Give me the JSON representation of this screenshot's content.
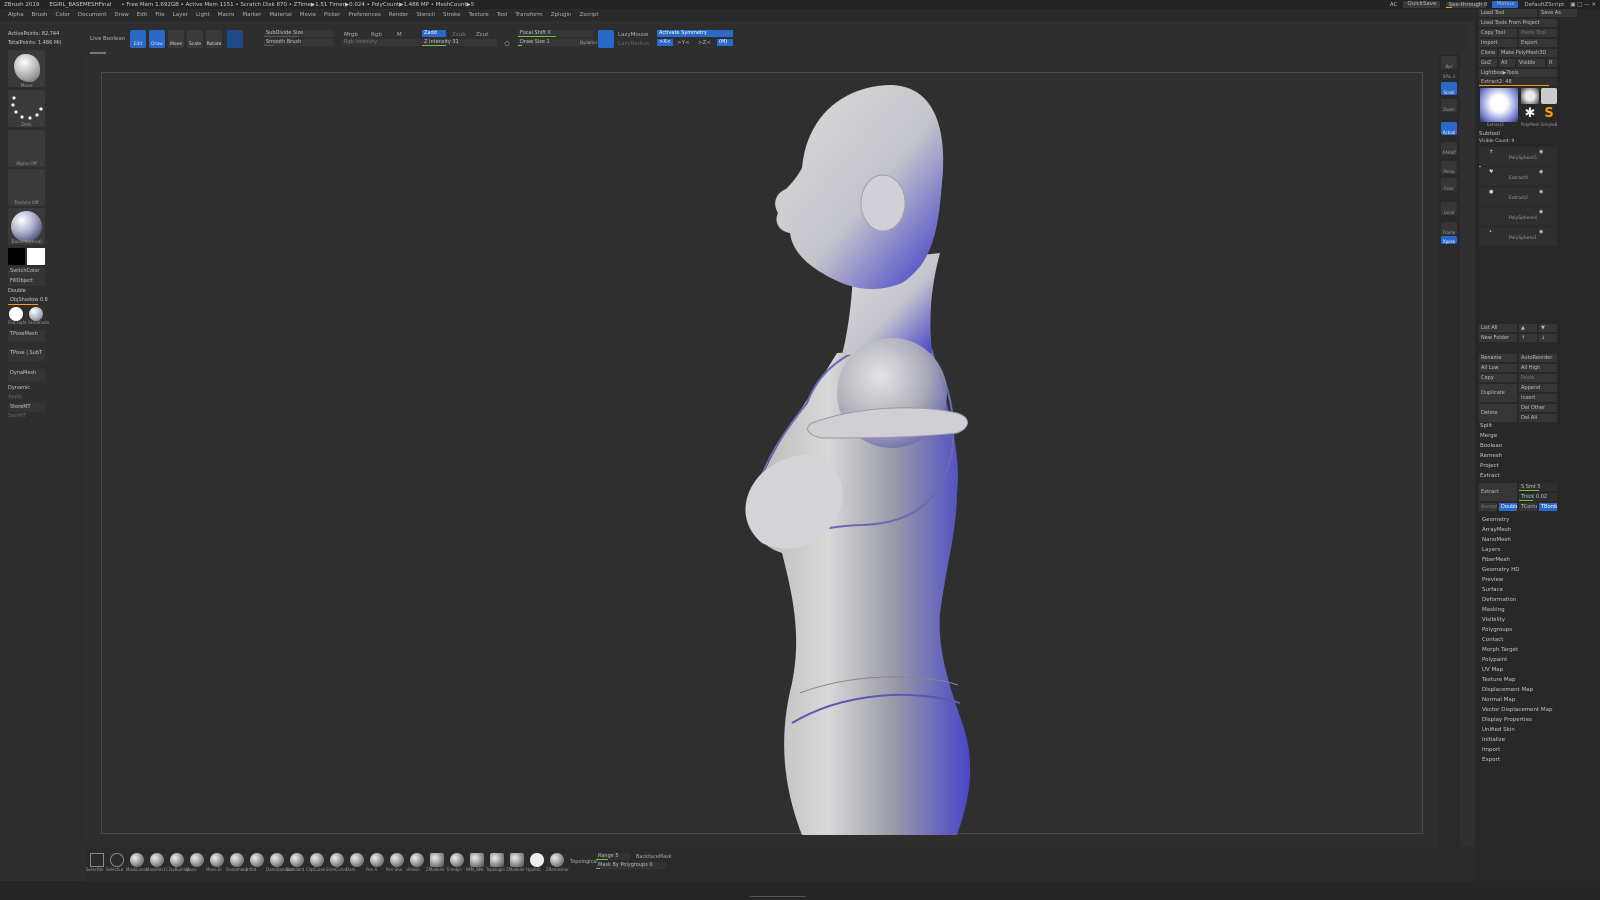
{
  "titlebar": {
    "app": "ZBrush 2019",
    "file": "EGIRL_BASEMESHFinal",
    "stats": "• Free Mem 1.692GB • Active Mem 1151 • Scratch Disk 870 • ZTime▶1.51 Timer▶0.024 • PolyCount▶1.486 MP • MeshCount▶5",
    "ac": "AC",
    "quicksave": "QuickSave",
    "seethrough": "See-through 0",
    "menus": "Menus",
    "script": "DefaultZScript"
  },
  "menubar": [
    "Alpha",
    "Brush",
    "Color",
    "Document",
    "Draw",
    "Edit",
    "File",
    "Layer",
    "Light",
    "Macro",
    "Marker",
    "Material",
    "Movie",
    "Picker",
    "Preferences",
    "Render",
    "Stencil",
    "Stroke",
    "Texture",
    "Tool",
    "Transform",
    "Zplugin",
    "Zscript"
  ],
  "toptool": {
    "live_boolean": "Live Boolean",
    "buttons": [
      "Edit",
      "Draw",
      "Move",
      "Scale",
      "Rotate"
    ],
    "sdiv": "SubDivide Size",
    "smooth": "Smooth Brush",
    "mrgb": "Mrgb",
    "rgb": "Rgb",
    "m": "M",
    "rgb_int": "Rgb Intensity",
    "zadd": "Zadd",
    "zsub": "Zsub",
    "zcut": "Zcut",
    "zint": "Z Intensity 31",
    "focal": "Focal Shift 0",
    "drawsize": "Draw Size 1",
    "dynamic": "Dynamic",
    "lazymouse": "LazyMouse",
    "lazyradius": "LazyRadius",
    "symmetry": "Activate Symmetry",
    "x": ">X<",
    "y": ">Y<",
    "z": ">Z<",
    "m2": "(M)",
    "progress": 0.35
  },
  "leftshelf": {
    "activepoints": "ActivePoints: 82,744",
    "totalpoints": "TotalPoints: 1.486 Mil",
    "brush": "Move",
    "stroke": "Dots",
    "alpha": "Alpha Off",
    "texture": "Texture Off",
    "material": "BasicMaterial",
    "switchcolor": "SwitchColor",
    "fillobject": "FillObject",
    "double": "Double",
    "objshadow": "ObjShadow 0.8",
    "flat": "Flat Light",
    "mat2": "SkinShade",
    "tposemesh": "TPoseMesh",
    "tposesubt": "TPose | SubT",
    "dynamesh": "DynaMesh",
    "dynamic": "Dynamic",
    "apply": "Apply",
    "storemt": "StoreMT",
    "switchmt": "SwitMT"
  },
  "rightshelf": [
    "Bpr",
    "SPix 3",
    "Scroll",
    "Zoom",
    "Actual",
    "AAHalf",
    "Persp",
    "Floor",
    "Local",
    "Frame",
    "Move",
    "Scale",
    "Rotate",
    "Transp",
    "Ghost",
    "Solo",
    "Xpose"
  ],
  "rightpanel": {
    "top_rows": [
      [
        "Load Tool",
        "Save As"
      ],
      [
        "Load Tools From Project",
        ""
      ],
      [
        "Copy Tool",
        "Paste Tool"
      ],
      [
        "Import",
        "Export"
      ],
      [
        "Clone",
        "Make PolyMesh3D"
      ],
      [
        "GoZ",
        "All",
        "Visible",
        "R"
      ],
      [
        "Lightbox▶Tools",
        ""
      ]
    ],
    "extract_label": "Extract2: 48",
    "thumbs": [
      "Extract2",
      "Extract2",
      "PolyMesh",
      "SimpleB"
    ],
    "subtool_title": "Subtool",
    "visible_count": "Visible Count: 9",
    "subtools": [
      "PolySphere5",
      "Extract4",
      "Extract2",
      "PolySphere4",
      "PolySphere1"
    ],
    "list": [
      [
        "List All",
        "",
        ""
      ],
      [
        "New Folder",
        "",
        ""
      ],
      [
        "Rename",
        "AutoReorder"
      ],
      [
        "All Low",
        "All High"
      ],
      [
        "Copy",
        "Paste"
      ],
      [
        "Duplicate",
        "Append"
      ],
      [
        "",
        "Insert"
      ],
      [
        "Delete",
        "Del Other"
      ],
      [
        "",
        "Del All"
      ]
    ],
    "ops": [
      "Split",
      "Merge",
      "Boolean",
      "Remesh",
      "Project",
      "Extract"
    ],
    "extract_row": [
      "Extract",
      "S Smt 5",
      "Thick 0.02"
    ],
    "accept_row": [
      "Accept",
      "Double",
      "TCorne",
      "TBorde"
    ],
    "menus": [
      "Geometry",
      "ArrayMesh",
      "NanoMesh",
      "Layers",
      "FiberMesh",
      "Geometry HD",
      "Preview",
      "Surface",
      "Deformation",
      "Masking",
      "Visibility",
      "Polygroups",
      "Contact",
      "Morph Target",
      "Polypaint",
      "UV Map",
      "Texture Map",
      "Displacement Map",
      "Normal Map",
      "Vector Displacement Map",
      "Display Properties",
      "Unified Skin",
      "Initialize",
      "Import",
      "Export"
    ]
  },
  "bottomshelf": {
    "brushes": [
      "SelectRe",
      "SelectLa",
      "MaskLasso",
      "MaskRect",
      "ClayBuildup",
      "Move",
      "Move El",
      "Snakehook",
      "Inflat",
      "DamStandard",
      "Standard",
      "ClipCurve",
      "SliceCurve",
      "Dam",
      "Pen A",
      "Pen Sha",
      "sPolish",
      "ZModeler",
      "Trimdyn",
      "IMM_BPa",
      "Topologie",
      "ZModeler",
      "Hpolish",
      "ZRemesher"
    ],
    "topological": "Topological",
    "range": "Range 5",
    "backfacemask": "BackfaceMask",
    "mask_by_polygroups": "Mask By Polygroups 0"
  },
  "colors": {
    "accent": "#2a69c7",
    "bg": "#303030",
    "slider_orange": "#f0a000",
    "slider_green": "#6fc23a",
    "mesh_blue": "#3a35c8"
  }
}
